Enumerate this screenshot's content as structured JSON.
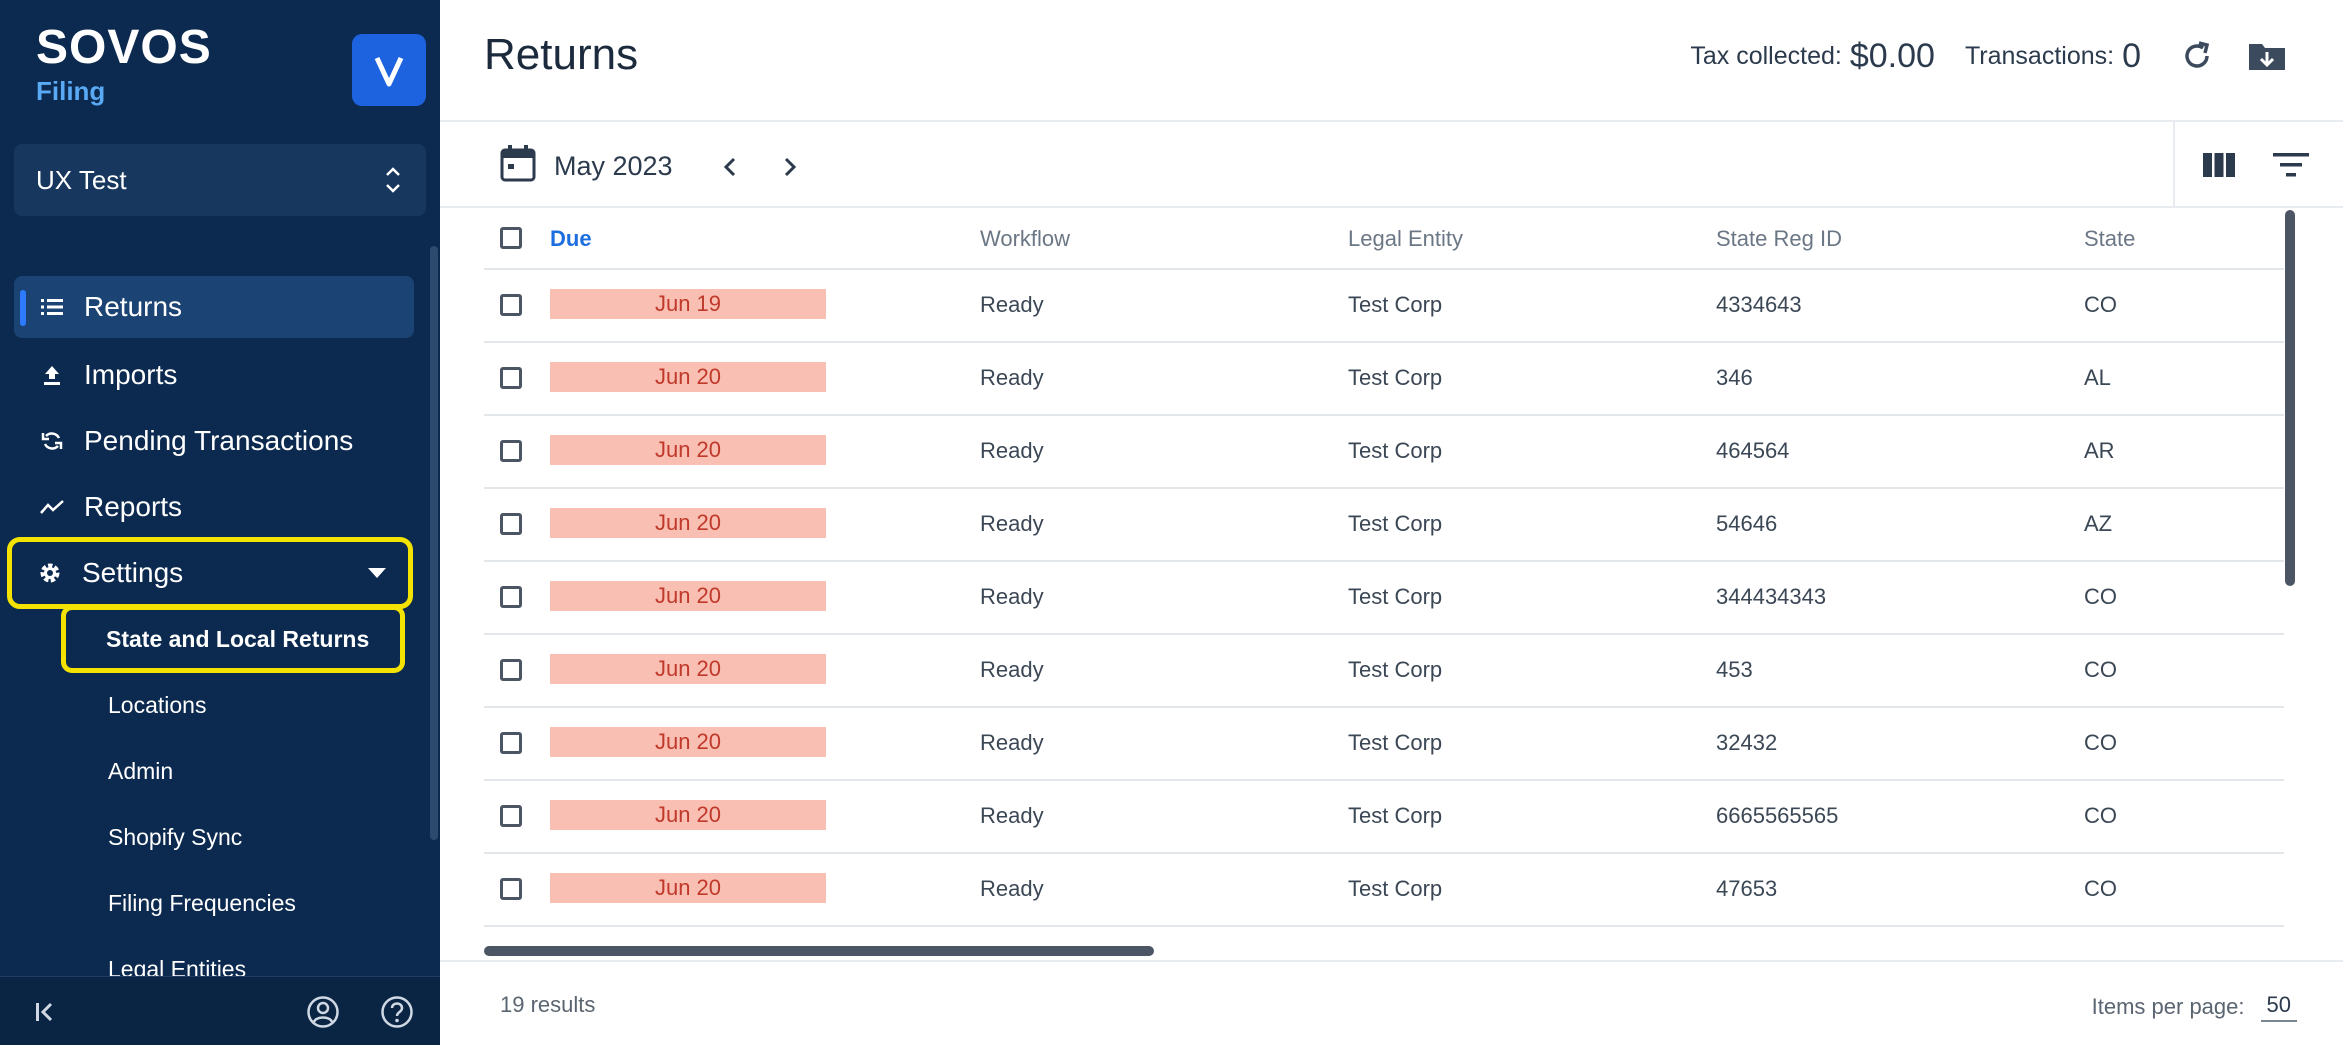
{
  "brand": {
    "logo": "SOVOS",
    "product": "Filing",
    "switcher_letter": "V"
  },
  "org": {
    "name": "UX Test"
  },
  "nav": [
    {
      "label": "Returns",
      "icon": "list-icon",
      "active": true
    },
    {
      "label": "Imports",
      "icon": "upload-icon"
    },
    {
      "label": "Pending Transactions",
      "icon": "sync-icon"
    },
    {
      "label": "Reports",
      "icon": "trend-icon"
    },
    {
      "label": "Settings",
      "icon": "gear-icon",
      "expanded": true
    }
  ],
  "settings_sub": [
    {
      "label": "State and Local Returns",
      "highlighted": true
    },
    {
      "label": "Locations"
    },
    {
      "label": "Admin"
    },
    {
      "label": "Shopify Sync"
    },
    {
      "label": "Filing Frequencies"
    },
    {
      "label": "Legal Entities"
    }
  ],
  "header": {
    "title": "Returns",
    "tax_collected_label": "Tax collected:",
    "tax_collected_value": "$0.00",
    "transactions_label": "Transactions:",
    "transactions_value": "0"
  },
  "toolbar": {
    "period": "May 2023"
  },
  "table": {
    "columns": [
      "Due",
      "Workflow",
      "Legal Entity",
      "State Reg ID",
      "State"
    ],
    "sorted_column": "Due",
    "rows": [
      {
        "due": "Jun 19",
        "workflow": "Ready",
        "entity": "Test Corp",
        "reg_id": "4334643",
        "state": "CO"
      },
      {
        "due": "Jun 20",
        "workflow": "Ready",
        "entity": "Test Corp",
        "reg_id": "346",
        "state": "AL"
      },
      {
        "due": "Jun 20",
        "workflow": "Ready",
        "entity": "Test Corp",
        "reg_id": "464564",
        "state": "AR"
      },
      {
        "due": "Jun 20",
        "workflow": "Ready",
        "entity": "Test Corp",
        "reg_id": "54646",
        "state": "AZ"
      },
      {
        "due": "Jun 20",
        "workflow": "Ready",
        "entity": "Test Corp",
        "reg_id": "344434343",
        "state": "CO"
      },
      {
        "due": "Jun 20",
        "workflow": "Ready",
        "entity": "Test Corp",
        "reg_id": "453",
        "state": "CO"
      },
      {
        "due": "Jun 20",
        "workflow": "Ready",
        "entity": "Test Corp",
        "reg_id": "32432",
        "state": "CO"
      },
      {
        "due": "Jun 20",
        "workflow": "Ready",
        "entity": "Test Corp",
        "reg_id": "6665565565",
        "state": "CO"
      },
      {
        "due": "Jun 20",
        "workflow": "Ready",
        "entity": "Test Corp",
        "reg_id": "47653",
        "state": "CO"
      }
    ]
  },
  "footer": {
    "results": "19 results",
    "items_per_page_label": "Items per page:",
    "items_per_page_value": "50"
  },
  "colors": {
    "sidebar_bg": "#0c2a4f",
    "accent": "#1d63e0",
    "highlight": "#f4e200",
    "overdue_bg": "#f9bfb2",
    "overdue_text": "#c0392b"
  }
}
